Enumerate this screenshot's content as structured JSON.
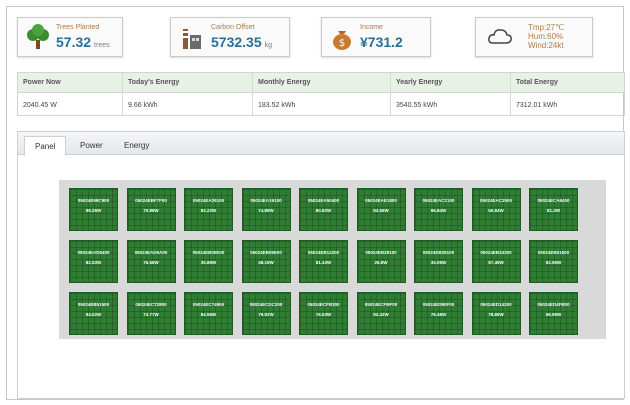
{
  "cards": {
    "trees": {
      "label": "Trees Planted",
      "value": "57.32",
      "unit": "trees",
      "icon": "tree-icon"
    },
    "carbon": {
      "label": "Carbon Offset",
      "value": "5732.35",
      "unit": "kg",
      "icon": "factory-icon"
    },
    "income": {
      "label": "Income",
      "value": "¥731.2",
      "icon": "money-bag-icon"
    },
    "weather": {
      "tmp": "Tmp:27℃",
      "hum": "Hum:60%",
      "wind": "Wind:24kt",
      "icon": "cloud-icon"
    }
  },
  "energy": {
    "headers": [
      "Power Now",
      "Today's Energy",
      "Monthly Energy",
      "Yearly Energy",
      "Total Energy"
    ],
    "values": [
      "2040.45 W",
      "9.66 kWh",
      "183.52 kWh",
      "3540.55 kWh",
      "7312.01 kWh"
    ]
  },
  "tabs": [
    "Panel",
    "Power",
    "Energy"
  ],
  "active_tab": "Panel",
  "panels": [
    {
      "id": "05024E99C900",
      "power": "99.25W"
    },
    {
      "id": "05024EBF7F00",
      "power": "70.98W"
    },
    {
      "id": "05024EA26100",
      "power": "92.22W"
    },
    {
      "id": "05024EA16100",
      "power": "74.89W"
    },
    {
      "id": "05024EA50400",
      "power": "80.82W"
    },
    {
      "id": "05024EAE1800",
      "power": "93.56W"
    },
    {
      "id": "05024EAC2100",
      "power": "96.84W"
    },
    {
      "id": "05024EAC2500",
      "power": "55.84W"
    },
    {
      "id": "05024ECA6400",
      "power": "81.3W"
    },
    {
      "id": "05024EAD6400",
      "power": "82.53W"
    },
    {
      "id": "05024EAD6A00",
      "power": "76.58W"
    },
    {
      "id": "05024EB00E00",
      "power": "35.89W"
    },
    {
      "id": "05024EB09E00",
      "power": "48.16W"
    },
    {
      "id": "05024EB12200",
      "power": "81.43W"
    },
    {
      "id": "05024EB28100",
      "power": "26.8W"
    },
    {
      "id": "05024EB28100",
      "power": "35.06W"
    },
    {
      "id": "05024EB34300",
      "power": "87.45W"
    },
    {
      "id": "05024EB51500",
      "power": "92.55W"
    },
    {
      "id": "05024EB51500",
      "power": "94.02W"
    },
    {
      "id": "05024EC72800",
      "power": "73.77W"
    },
    {
      "id": "05024EC74900",
      "power": "84.55W"
    },
    {
      "id": "05024ECDC200",
      "power": "79.92W"
    },
    {
      "id": "05024ECFB300",
      "power": "76.53W"
    },
    {
      "id": "05024ECFBF00",
      "power": "92.42W"
    },
    {
      "id": "05024ED80F00",
      "power": "76.48W"
    },
    {
      "id": "05024ED14200",
      "power": "78.86W"
    },
    {
      "id": "05024ED4FB00",
      "power": "59.69W"
    }
  ]
}
